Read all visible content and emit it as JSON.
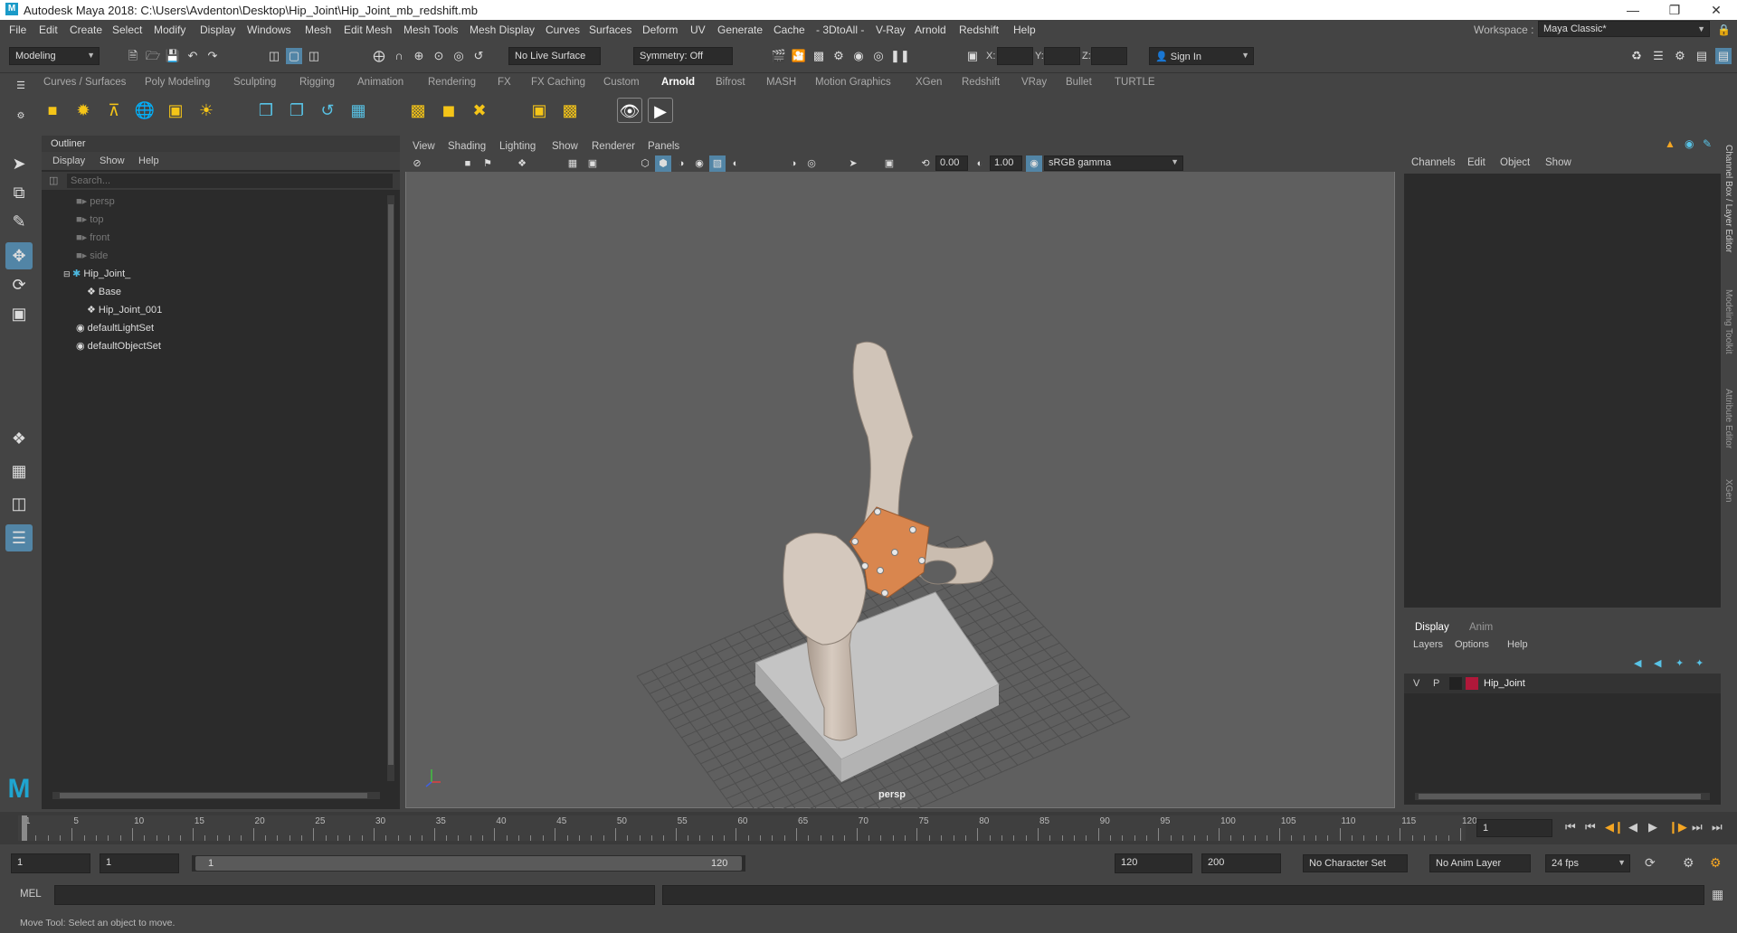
{
  "window": {
    "title": "Autodesk Maya 2018: C:\\Users\\Avdenton\\Desktop\\Hip_Joint\\Hip_Joint_mb_redshift.mb"
  },
  "menubar": [
    "File",
    "Edit",
    "Create",
    "Select",
    "Modify",
    "Display",
    "Windows",
    "Mesh",
    "Edit Mesh",
    "Mesh Tools",
    "Mesh Display",
    "Curves",
    "Surfaces",
    "Deform",
    "UV",
    "Generate",
    "Cache",
    "- 3DtoAll -",
    "V-Ray",
    "Arnold",
    "Redshift",
    "Help"
  ],
  "workspace": {
    "label": "Workspace :",
    "value": "Maya Classic*"
  },
  "statusline": {
    "menuset": "Modeling",
    "live_surface": "No Live Surface",
    "symmetry": "Symmetry: Off",
    "x_label": "X:",
    "y_label": "Y:",
    "z_label": "Z:",
    "sign_in": "Sign In"
  },
  "shelf_tabs": [
    "Curves / Surfaces",
    "Poly Modeling",
    "Sculpting",
    "Rigging",
    "Animation",
    "Rendering",
    "FX",
    "FX Caching",
    "Custom",
    "Arnold",
    "Bifrost",
    "MASH",
    "Motion Graphics",
    "XGen",
    "Redshift",
    "VRay",
    "Bullet",
    "TURTLE"
  ],
  "active_shelf": "Arnold",
  "outliner": {
    "title": "Outliner",
    "menus": [
      "Display",
      "Show",
      "Help"
    ],
    "search_placeholder": "Search...",
    "items": [
      {
        "label": "persp",
        "icon": "camera-icon",
        "dim": true
      },
      {
        "label": "top",
        "icon": "camera-icon",
        "dim": true
      },
      {
        "label": "front",
        "icon": "camera-icon",
        "dim": true
      },
      {
        "label": "side",
        "icon": "camera-icon",
        "dim": true
      },
      {
        "label": "Hip_Joint_",
        "icon": "joint-icon",
        "dim": false
      },
      {
        "label": "Base",
        "icon": "mesh-icon",
        "dim": false
      },
      {
        "label": "Hip_Joint_001",
        "icon": "mesh-icon",
        "dim": false
      },
      {
        "label": "defaultLightSet",
        "icon": "set-icon",
        "dim": false
      },
      {
        "label": "defaultObjectSet",
        "icon": "set-icon",
        "dim": false
      }
    ]
  },
  "viewport": {
    "menus": [
      "View",
      "Shading",
      "Lighting",
      "Show",
      "Renderer",
      "Panels"
    ],
    "exposure": "0.00",
    "gamma": "1.00",
    "color_space": "sRGB gamma",
    "camera_label": "persp"
  },
  "channelbox": {
    "menus": [
      "Channels",
      "Edit",
      "Object",
      "Show"
    ]
  },
  "layers": {
    "tabs": [
      "Display",
      "Anim"
    ],
    "menus": [
      "Layers",
      "Options",
      "Help"
    ],
    "rows": [
      {
        "v": "V",
        "p": "P",
        "name": "Hip_Joint",
        "color": "#b0183a"
      }
    ]
  },
  "right_strip": [
    "Channel Box / Layer Editor",
    "Modeling Toolkit",
    "Attribute Editor",
    "XGen"
  ],
  "timeline": {
    "ticks": [
      "1",
      "5",
      "10",
      "15",
      "20",
      "25",
      "30",
      "35",
      "40",
      "45",
      "50",
      "55",
      "60",
      "65",
      "70",
      "75",
      "80",
      "85",
      "90",
      "95",
      "100",
      "105",
      "110",
      "115",
      "120"
    ],
    "current_frame": "1"
  },
  "range": {
    "start": "1",
    "anim_start": "1",
    "slider_start": "1",
    "slider_end": "120",
    "end": "120",
    "anim_end": "200",
    "character_set": "No Character Set",
    "anim_layer": "No Anim Layer",
    "fps": "24 fps"
  },
  "cmdline": {
    "label": "MEL"
  },
  "helpline": {
    "text": "Move Tool: Select an object to move."
  },
  "colors": {
    "accent": "#5285a6",
    "orange_part": "#d9864e",
    "bone": "#cfc3b6"
  }
}
